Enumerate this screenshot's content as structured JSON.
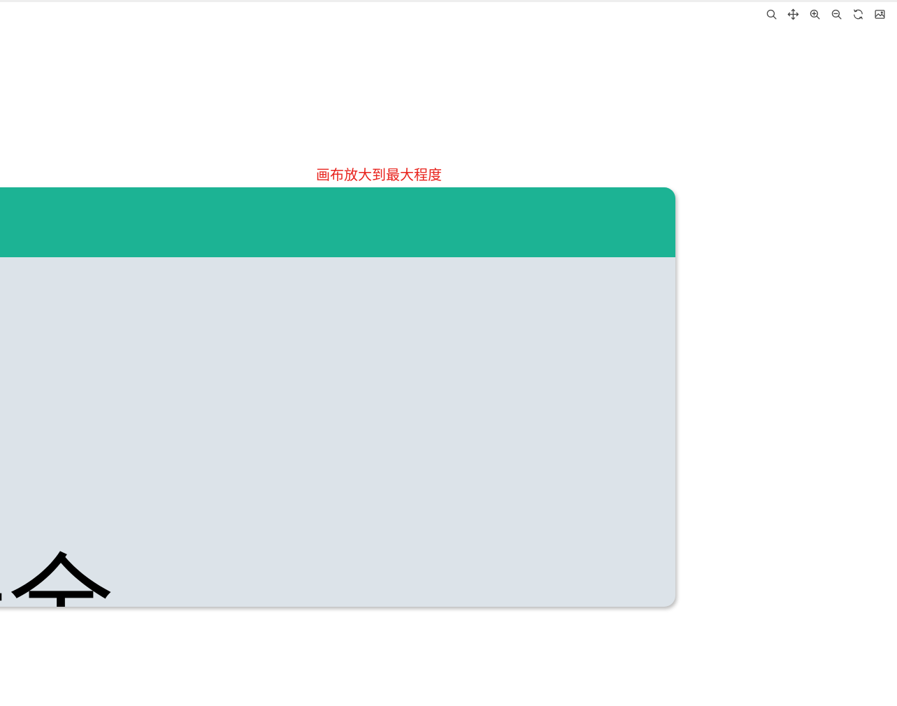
{
  "toolbar": {
    "icons": [
      "search-icon",
      "move-icon",
      "zoom-in-icon",
      "zoom-out-icon",
      "refresh-icon",
      "image-icon"
    ]
  },
  "canvas": {
    "hint_text": "画布放大到最大程度",
    "hint_color": "#e8221c"
  },
  "card": {
    "header_color": "#1cb394",
    "body_color": "#dce3e9",
    "text": "安全"
  }
}
